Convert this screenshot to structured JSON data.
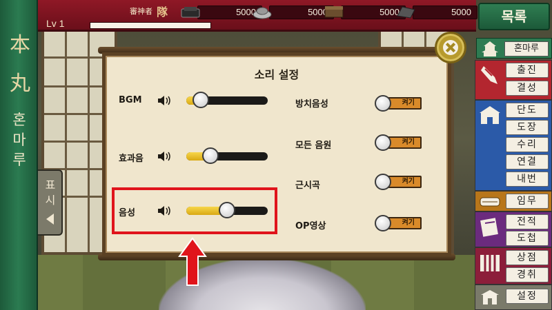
{
  "topbar": {
    "level": "Lv 1",
    "owner_label": "審神者",
    "owner_name": "隊",
    "resources": [
      {
        "icon": "charcoal-icon",
        "value": "5000"
      },
      {
        "icon": "steel-icon",
        "value": "5000"
      },
      {
        "icon": "coolant-icon",
        "value": "5000"
      },
      {
        "icon": "whetstone-icon",
        "value": "5000"
      }
    ]
  },
  "left_banner": {
    "char1": "本",
    "char2": "丸",
    "sub": [
      "혼",
      "마",
      "루"
    ]
  },
  "side_tab": {
    "text": [
      "표",
      "시"
    ]
  },
  "right_menu": {
    "list_button": "목록",
    "head_label": "혼마루",
    "groups": [
      {
        "icon": "sortie-icon",
        "color": "#b3262f",
        "items": [
          "출진",
          "결성"
        ]
      },
      {
        "icon": "smithy-icon",
        "color": "#2b5aa8",
        "items": [
          "단도",
          "도장",
          "수리",
          "연결",
          "내번"
        ]
      },
      {
        "icon": "mission-icon",
        "color": "#b8761a",
        "items": [
          "임무"
        ]
      },
      {
        "icon": "record-icon",
        "color": "#6b2b7e",
        "items": [
          "전적",
          "도첩"
        ]
      },
      {
        "icon": "shop-icon",
        "color": "#8c1e3a",
        "items": [
          "상점",
          "경취"
        ]
      },
      {
        "icon": "settings-icon",
        "color": "#7a7a6a",
        "items": [
          "설정"
        ]
      }
    ]
  },
  "dialog": {
    "title": "소리 설정",
    "sliders": [
      {
        "label": "BGM",
        "value": 0.18
      },
      {
        "label": "효과음",
        "value": 0.3
      },
      {
        "label": "음성",
        "value": 0.5
      }
    ],
    "toggles": [
      {
        "label": "방치음성",
        "state": "켜기"
      },
      {
        "label": "모든 음원",
        "state": "켜기"
      },
      {
        "label": "근시곡",
        "state": "켜기"
      },
      {
        "label": "OP영상",
        "state": "켜기"
      }
    ]
  },
  "colors": {
    "accent_red": "#e0141b",
    "banner_green": "#2b7b51",
    "topbar_red": "#8f1826",
    "slider_fill": "#f7d64a",
    "toggle_orange": "#d98a2a"
  }
}
